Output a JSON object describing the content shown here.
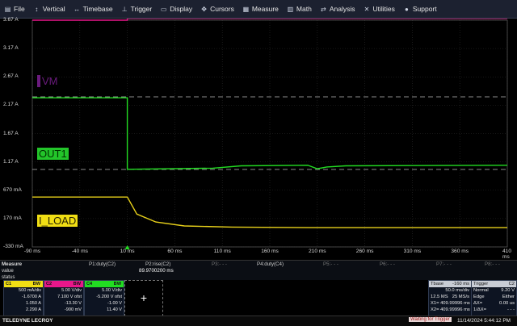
{
  "menu": [
    {
      "label": "File",
      "icon": "file-icon",
      "glyph": "▤"
    },
    {
      "label": "Vertical",
      "icon": "vertical-icon",
      "glyph": "↕"
    },
    {
      "label": "Timebase",
      "icon": "timebase-icon",
      "glyph": "↔"
    },
    {
      "label": "Trigger",
      "icon": "trigger-icon",
      "glyph": "⊥"
    },
    {
      "label": "Display",
      "icon": "display-icon",
      "glyph": "▭"
    },
    {
      "label": "Cursors",
      "icon": "cursors-icon",
      "glyph": "✥"
    },
    {
      "label": "Measure",
      "icon": "measure-icon",
      "glyph": "▦"
    },
    {
      "label": "Math",
      "icon": "math-icon",
      "glyph": "▥"
    },
    {
      "label": "Analysis",
      "icon": "analysis-icon",
      "glyph": "⇄"
    },
    {
      "label": "Utilities",
      "icon": "utilities-icon",
      "glyph": "✕"
    },
    {
      "label": "Support",
      "icon": "support-icon",
      "glyph": "●"
    }
  ],
  "y_axis": [
    "3.67 A",
    "3.17 A",
    "2.67 A",
    "2.17 A",
    "1.67 A",
    "1.17 A",
    "670 mA",
    "170 mA",
    "-330 mA"
  ],
  "x_axis": [
    "-90 ms",
    "-40 ms",
    "10 ms",
    "60 ms",
    "110 ms",
    "160 ms",
    "210 ms",
    "260 ms",
    "310 ms",
    "360 ms",
    "410 ms"
  ],
  "traces": {
    "vm": {
      "label": "VM",
      "color": "#e8178a",
      "label_bg": "#6b1b7e",
      "label_color": "#7a0f7a"
    },
    "out1": {
      "label": "OUT1",
      "color": "#22dd22",
      "label_bg": "#23c52a",
      "label_color": "#003300"
    },
    "iload": {
      "label": "I_LOAD",
      "color": "#e8d11a",
      "label_bg": "#f0de14",
      "label_color": "#2a2400"
    }
  },
  "chart_data": {
    "type": "line",
    "title": "",
    "x_unit": "ms",
    "xlim": [
      -90,
      410
    ],
    "ylim": [
      -330,
      3670
    ],
    "series": [
      {
        "name": "VM",
        "points": [
          [
            -90,
            3670
          ],
          [
            10,
            3670
          ],
          [
            10,
            3700
          ],
          [
            410,
            3700
          ]
        ]
      },
      {
        "name": "OUT1",
        "points": [
          [
            -90,
            2300
          ],
          [
            10,
            2300
          ],
          [
            10,
            1040
          ],
          [
            100,
            1060
          ],
          [
            130,
            1100
          ],
          [
            200,
            1110
          ],
          [
            210,
            1050
          ],
          [
            220,
            1080
          ],
          [
            240,
            1100
          ],
          [
            410,
            1110
          ]
        ]
      },
      {
        "name": "I_LOAD",
        "points": [
          [
            -90,
            550
          ],
          [
            10,
            550
          ],
          [
            20,
            250
          ],
          [
            40,
            110
          ],
          [
            70,
            40
          ],
          [
            120,
            20
          ],
          [
            210,
            10
          ],
          [
            410,
            10
          ]
        ]
      }
    ]
  },
  "measure": {
    "row1": "Measure",
    "row2": "value",
    "row3": "status",
    "p1": "P1:duty(C2)",
    "p2": "P2:rise(C2)",
    "p2_val": "89.9700200 ms",
    "p3": "P3:- - -",
    "p4": "P4:duty(C4)",
    "p5": "P5:- - -",
    "p6": "P6:- - -",
    "p7": "P7:- - -",
    "p8": "P8:- - -",
    "dashes": "- - -"
  },
  "channels": [
    {
      "id": "C1",
      "tag": "BW",
      "hdr_bg": "#f0de14",
      "lines": [
        "500 mA/div",
        "-1.6700 A",
        "1.050 A",
        "2.290 A"
      ]
    },
    {
      "id": "C2",
      "tag": "BW",
      "hdr_bg": "#e8178a",
      "lines": [
        "5.00 V/div",
        "7.100 V ofst",
        "-13.30 V",
        "-900 mV"
      ]
    },
    {
      "id": "C4",
      "tag": "BW",
      "hdr_bg": "#22dd22",
      "lines": [
        "5.00 V/div",
        "-5.200 V ofst",
        "-1.00 V",
        "11.40 V"
      ]
    }
  ],
  "add_label": "+",
  "timebase": {
    "title": "Tbase",
    "delay": "-160 ms",
    "l1": "50.0 ms/div",
    "l2": "12.5 MS",
    "l3": "25 MS/s",
    "x1": "X1= 409.99996 ms",
    "x2": "X2= 409.99996 ms"
  },
  "trigger": {
    "title": "Trigger",
    "ch": "C2",
    "l1": "Normal",
    "l1v": "9.20 V",
    "l2": "Edge",
    "l2v": "Either",
    "dx": "ΔX=",
    "dxv": "0.00 us",
    "idx": "1/ΔX=",
    "idxv": "- - -"
  },
  "footer": {
    "brand": "TELEDYNE LECROY",
    "status": "Waiting for Trigger",
    "datetime": "11/14/2024 5:44:12 PM"
  }
}
